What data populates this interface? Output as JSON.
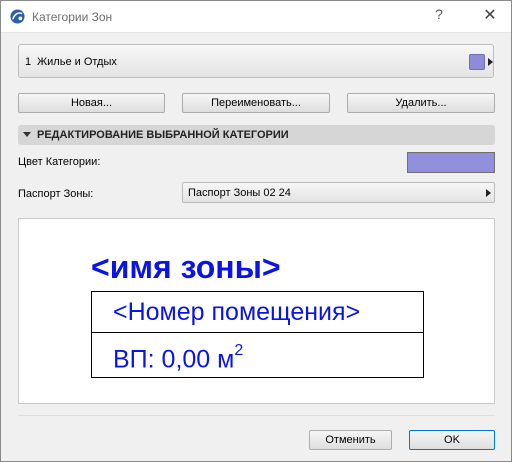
{
  "window": {
    "title": "Категории Зон",
    "help_label": "?",
    "close_label": "✕"
  },
  "category": {
    "number": "1",
    "name": "Жилье и Отдых",
    "swatch_color": "#8c8cd8"
  },
  "actions": {
    "new_label": "Новая...",
    "rename_label": "Переименовать...",
    "delete_label": "Удалить..."
  },
  "section": {
    "title": "РЕДАКТИРОВАНИЕ ВЫБРАННОЙ КАТЕГОРИИ"
  },
  "color_field": {
    "label": "Цвет Категории:",
    "color": "#9090dc"
  },
  "passport_field": {
    "label": "Паспорт Зоны:",
    "value": "Паспорт Зоны 02 24"
  },
  "preview": {
    "zone_name": "<имя зоны>",
    "room_number": "<Номер помещения>",
    "area_text": "ВП: 0,00 м",
    "area_superscript": "2",
    "text_color": "#0b15e3"
  },
  "footer": {
    "cancel_label": "Отменить",
    "ok_label": "OK"
  }
}
